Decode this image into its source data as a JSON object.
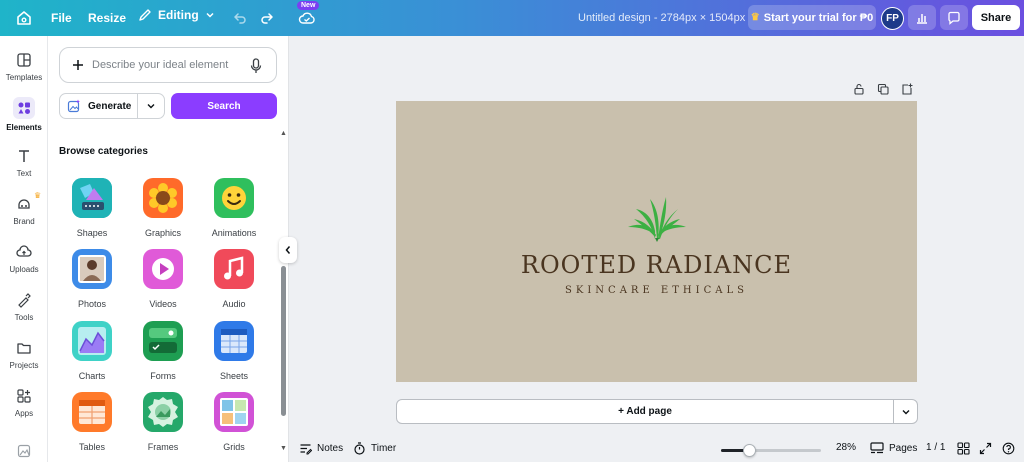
{
  "topbar": {
    "file_label": "File",
    "resize_label": "Resize",
    "mode_label": "Editing",
    "new_badge": "New",
    "design_title": "Untitled design - 2784px × 1504px",
    "trial_label": "Start your trial for ₱0",
    "avatar_initials": "FP",
    "share_label": "Share"
  },
  "rail": {
    "items": [
      {
        "label": "Templates",
        "icon": "templates-icon"
      },
      {
        "label": "Elements",
        "icon": "elements-icon"
      },
      {
        "label": "Text",
        "icon": "text-icon"
      },
      {
        "label": "Brand",
        "icon": "brand-icon"
      },
      {
        "label": "Uploads",
        "icon": "uploads-icon"
      },
      {
        "label": "Tools",
        "icon": "tools-icon"
      },
      {
        "label": "Projects",
        "icon": "projects-icon"
      },
      {
        "label": "Apps",
        "icon": "apps-icon"
      }
    ]
  },
  "panel": {
    "search_placeholder": "Describe your ideal element",
    "generate_label": "Generate",
    "search_button": "Search",
    "browse_title": "Browse categories",
    "categories": [
      {
        "label": "Shapes"
      },
      {
        "label": "Graphics"
      },
      {
        "label": "Animations"
      },
      {
        "label": "Photos"
      },
      {
        "label": "Videos"
      },
      {
        "label": "Audio"
      },
      {
        "label": "Charts"
      },
      {
        "label": "Forms"
      },
      {
        "label": "Sheets"
      },
      {
        "label": "Tables"
      },
      {
        "label": "Frames"
      },
      {
        "label": "Grids"
      }
    ]
  },
  "design": {
    "brand_name": "ROOTED RADIANCE",
    "tagline": "SKINCARE ETHICALS",
    "background": "#c9c0ad",
    "text_color": "#4a3520",
    "leaf_color": "#3cb043"
  },
  "canvas": {
    "add_page_label": "+ Add page"
  },
  "bottombar": {
    "notes_label": "Notes",
    "timer_label": "Timer",
    "zoom": "28%",
    "zoom_fraction": 0.28,
    "pages_label": "Pages",
    "page_count": "1 / 1"
  },
  "colors": {
    "accent": "#8b3dff",
    "topbar_start": "#1fb4c9",
    "topbar_end": "#6b4fe0"
  }
}
